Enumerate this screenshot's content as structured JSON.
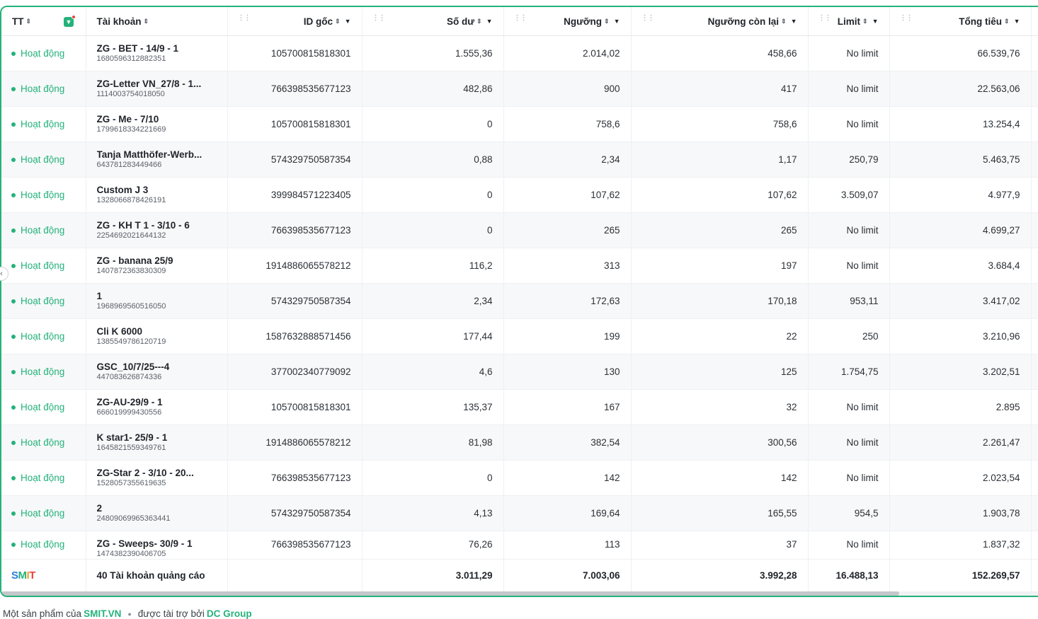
{
  "colors": {
    "accent": "#24b27b",
    "notify_dot": "#f0413e"
  },
  "table": {
    "headers": {
      "tt": "TT",
      "account": "Tài khoản",
      "id_goc": "ID gốc",
      "so_du": "Số dư",
      "nguong": "Ngưỡng",
      "nguong_con_lai": "Ngưỡng còn lại",
      "limit": "Limit",
      "tong_tieu": "Tổng tiêu"
    },
    "rows": [
      {
        "status": "Hoạt động",
        "name": "ZG - BET - 14/9 - 1",
        "acc_id": "1680596312882351",
        "id_goc": "105700815818301",
        "so_du": "1.555,36",
        "nguong": "2.014,02",
        "nguong_con_lai": "458,66",
        "limit": "No limit",
        "tong_tieu": "66.539,76"
      },
      {
        "status": "Hoạt động",
        "name": "ZG-Letter VN_27/8 - 1...",
        "acc_id": "1114003754018050",
        "id_goc": "766398535677123",
        "so_du": "482,86",
        "nguong": "900",
        "nguong_con_lai": "417",
        "limit": "No limit",
        "tong_tieu": "22.563,06"
      },
      {
        "status": "Hoạt động",
        "name": "ZG - Me - 7/10",
        "acc_id": "1799618334221669",
        "id_goc": "105700815818301",
        "so_du": "0",
        "nguong": "758,6",
        "nguong_con_lai": "758,6",
        "limit": "No limit",
        "tong_tieu": "13.254,4"
      },
      {
        "status": "Hoạt động",
        "name": "Tanja Matthöfer-Werb...",
        "acc_id": "643781283449466",
        "id_goc": "574329750587354",
        "so_du": "0,88",
        "nguong": "2,34",
        "nguong_con_lai": "1,17",
        "limit": "250,79",
        "tong_tieu": "5.463,75"
      },
      {
        "status": "Hoạt động",
        "name": "Custom J 3",
        "acc_id": "1328066878426191",
        "id_goc": "399984571223405",
        "so_du": "0",
        "nguong": "107,62",
        "nguong_con_lai": "107,62",
        "limit": "3.509,07",
        "tong_tieu": "4.977,9"
      },
      {
        "status": "Hoạt động",
        "name": "ZG - KH T 1 - 3/10 - 6",
        "acc_id": "2254692021644132",
        "id_goc": "766398535677123",
        "so_du": "0",
        "nguong": "265",
        "nguong_con_lai": "265",
        "limit": "No limit",
        "tong_tieu": "4.699,27"
      },
      {
        "status": "Hoạt động",
        "name": "ZG - banana 25/9",
        "acc_id": "1407872363830309",
        "id_goc": "1914886065578212",
        "so_du": "116,2",
        "nguong": "313",
        "nguong_con_lai": "197",
        "limit": "No limit",
        "tong_tieu": "3.684,4"
      },
      {
        "status": "Hoạt động",
        "name": "1",
        "acc_id": "1968969560516050",
        "id_goc": "574329750587354",
        "so_du": "2,34",
        "nguong": "172,63",
        "nguong_con_lai": "170,18",
        "limit": "953,11",
        "tong_tieu": "3.417,02"
      },
      {
        "status": "Hoạt động",
        "name": "Cli K 6000",
        "acc_id": "1385549786120719",
        "id_goc": "1587632888571456",
        "so_du": "177,44",
        "nguong": "199",
        "nguong_con_lai": "22",
        "limit": "250",
        "tong_tieu": "3.210,96"
      },
      {
        "status": "Hoạt động",
        "name": "GSC_10/7/25---4",
        "acc_id": "447083626874336",
        "id_goc": "377002340779092",
        "so_du": "4,6",
        "nguong": "130",
        "nguong_con_lai": "125",
        "limit": "1.754,75",
        "tong_tieu": "3.202,51"
      },
      {
        "status": "Hoạt động",
        "name": "ZG-AU-29/9 - 1",
        "acc_id": "666019999430556",
        "id_goc": "105700815818301",
        "so_du": "135,37",
        "nguong": "167",
        "nguong_con_lai": "32",
        "limit": "No limit",
        "tong_tieu": "2.895"
      },
      {
        "status": "Hoạt động",
        "name": "K star1- 25/9 - 1",
        "acc_id": "1645821559349761",
        "id_goc": "1914886065578212",
        "so_du": "81,98",
        "nguong": "382,54",
        "nguong_con_lai": "300,56",
        "limit": "No limit",
        "tong_tieu": "2.261,47"
      },
      {
        "status": "Hoạt động",
        "name": "ZG-Star 2 - 3/10 - 20...",
        "acc_id": "1528057355619635",
        "id_goc": "766398535677123",
        "so_du": "0",
        "nguong": "142",
        "nguong_con_lai": "142",
        "limit": "No limit",
        "tong_tieu": "2.023,54"
      },
      {
        "status": "Hoạt động",
        "name": "2",
        "acc_id": "24809069965363441",
        "id_goc": "574329750587354",
        "so_du": "4,13",
        "nguong": "169,64",
        "nguong_con_lai": "165,55",
        "limit": "954,5",
        "tong_tieu": "1.903,78"
      },
      {
        "status": "Hoạt động",
        "name": "ZG - Sweeps- 30/9 - 1",
        "acc_id": "1474382390406705",
        "id_goc": "766398535677123",
        "so_du": "76,26",
        "nguong": "113",
        "nguong_con_lai": "37",
        "limit": "No limit",
        "tong_tieu": "1.837,32"
      }
    ],
    "footer": {
      "logo": {
        "s": "S",
        "m": "M",
        "i": "I",
        "t": "T"
      },
      "count_label": "40 Tài khoản quảng cáo",
      "so_du": "3.011,29",
      "nguong": "7.003,06",
      "nguong_con_lai": "3.992,28",
      "limit": "16.488,13",
      "tong_tieu": "152.269,57"
    }
  },
  "page_footer": {
    "prefix": "Một sản phẩm của",
    "brand": "SMIT.VN",
    "sponsor_prefix": "được tài trợ bởi",
    "sponsor": "DC Group"
  }
}
